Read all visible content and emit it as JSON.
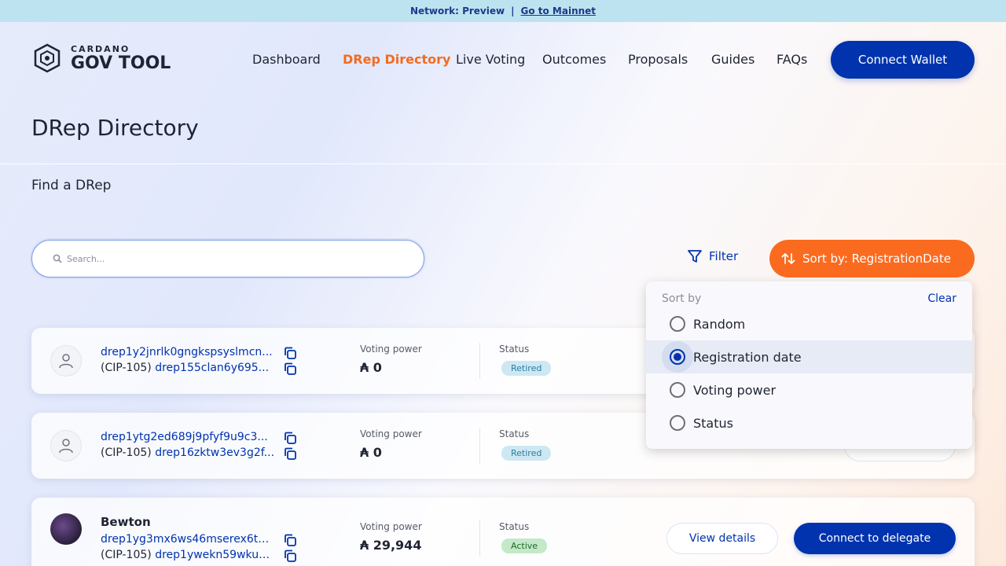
{
  "banner": {
    "network_text": "Network: Preview",
    "separator": "|",
    "link_text": "Go to Mainnet"
  },
  "logo": {
    "small": "CARDANO",
    "big": "GOV TOOL"
  },
  "nav": {
    "items": [
      {
        "label": "Dashboard",
        "active": false
      },
      {
        "label": "DRep Directory",
        "active": true
      },
      {
        "label": "Live Voting",
        "active": false
      },
      {
        "label": "Outcomes",
        "active": false
      },
      {
        "label": "Proposals",
        "active": false
      },
      {
        "label": "Guides",
        "active": false
      },
      {
        "label": "FAQs",
        "active": false
      }
    ],
    "connect_wallet": "Connect Wallet"
  },
  "page": {
    "title": "DRep Directory",
    "find_label": "Find a DRep"
  },
  "search": {
    "placeholder": "Search...",
    "value": ""
  },
  "toolbar": {
    "filter_label": "Filter",
    "sort_label": "Sort by: RegistrationDate"
  },
  "sort_dropdown": {
    "header": "Sort by",
    "clear": "Clear",
    "options": [
      {
        "label": "Random",
        "selected": false
      },
      {
        "label": "Registration date",
        "selected": true
      },
      {
        "label": "Voting power",
        "selected": false
      },
      {
        "label": "Status",
        "selected": false
      }
    ]
  },
  "dreps": [
    {
      "name": "",
      "id": "drep1y2jnrlk0gngkspsyslmcn...",
      "cip_prefix": "(CIP-105)",
      "cip_id": "drep155clan6y695...",
      "voting_power_label": "Voting power",
      "voting_power": "₳ 0",
      "status_label": "Status",
      "status": "Retired"
    },
    {
      "name": "",
      "id": "drep1ytg2ed689j9pfyf9u9c3...",
      "cip_prefix": "(CIP-105)",
      "cip_id": "drep16zktw3ev3g2f...",
      "voting_power_label": "Voting power",
      "voting_power": "₳ 0",
      "status_label": "Status",
      "status": "Retired",
      "view_details": "View details"
    },
    {
      "name": "Bewton",
      "id": "drep1yg3mx6ws46mserex6t5...",
      "cip_prefix": "(CIP-105)",
      "cip_id": "drep1ywekn59wkux...",
      "voting_power_label": "Voting power",
      "voting_power": "₳ 29,944",
      "status_label": "Status",
      "status": "Active",
      "view_details": "View details",
      "delegate": "Connect to delegate"
    }
  ],
  "colors": {
    "primary": "#0033ad",
    "accent": "#fb6b1f",
    "active_nav": "#f06c23"
  }
}
